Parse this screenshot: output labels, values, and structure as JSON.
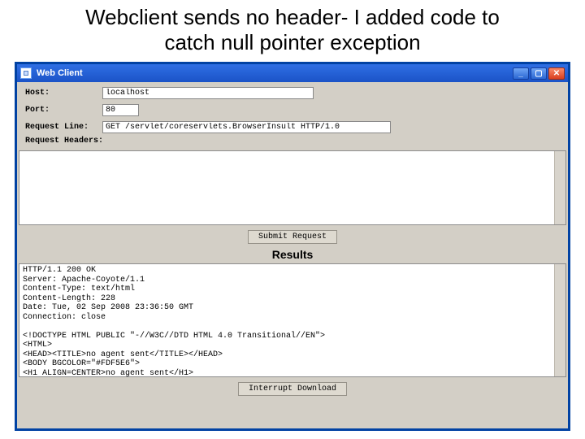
{
  "slide": {
    "title_l1": "Webclient sends no header- I added code to",
    "title_l2": "catch null pointer exception"
  },
  "window": {
    "title": "Web Client"
  },
  "form": {
    "host_label": "Host:",
    "host_value": "localhost",
    "port_label": "Port:",
    "port_value": "80",
    "request_label": "Request Line:",
    "request_value": "GET /servlet/coreservlets.BrowserInsult HTTP/1.0",
    "headers_label": "Request Headers:"
  },
  "buttons": {
    "submit": "Submit Request",
    "interrupt": "Interrupt Download"
  },
  "results": {
    "heading": "Results",
    "body": "HTTP/1.1 200 OK\nServer: Apache-Coyote/1.1\nContent-Type: text/html\nContent-Length: 228\nDate: Tue, 02 Sep 2008 23:36:50 GMT\nConnection: close\n\n<!DOCTYPE HTML PUBLIC \"-//W3C//DTD HTML 4.0 Transitional//EN\">\n<HTML>\n<HEAD><TITLE>no agent sent</TITLE></HEAD>\n<BODY BGCOLOR=\"#FDF5E6\">\n<H1 ALIGN=CENTER>no agent sent</H1>\nare you using some alternative client?\n</BODY></HTML>"
  }
}
